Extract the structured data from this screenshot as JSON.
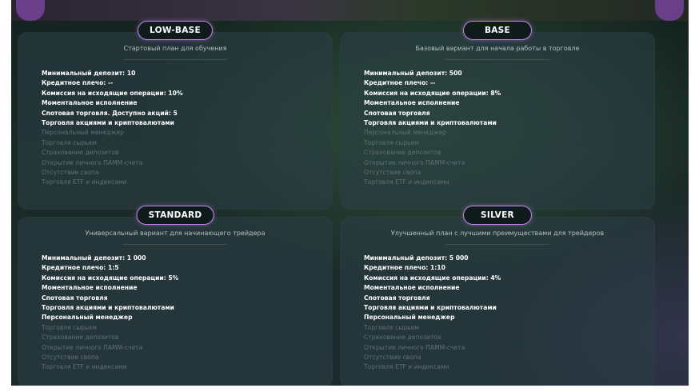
{
  "plans": [
    {
      "name": "LOW-BASE",
      "subtitle": "Стартовый план для обучения",
      "features": [
        {
          "text": "Минимальный депозит: 10",
          "enabled": true
        },
        {
          "text": "Кредитное плечо: --",
          "enabled": true
        },
        {
          "text": "Комиссия на исходящие операции: 10%",
          "enabled": true
        },
        {
          "text": "Моментальное исполнение",
          "enabled": true
        },
        {
          "text": "Спотовая торговля. Доступно акций: 5",
          "enabled": true
        },
        {
          "text": "Торговля акциями и криптовалютами",
          "enabled": true
        },
        {
          "text": "Персональный менеджер",
          "enabled": false
        },
        {
          "text": "Торговля сырьем",
          "enabled": false
        },
        {
          "text": "Страхование депозитов",
          "enabled": false
        },
        {
          "text": "Открытие личного ПАММ-счета",
          "enabled": false
        },
        {
          "text": "Отсутствие свопа",
          "enabled": false
        },
        {
          "text": "Торговля ETF и индексами",
          "enabled": false
        }
      ]
    },
    {
      "name": "BASE",
      "subtitle": "Базовый вариант для начала работы в торговле",
      "features": [
        {
          "text": "Минимальный депозит: 500",
          "enabled": true
        },
        {
          "text": "Кредитное плечо: --",
          "enabled": true
        },
        {
          "text": "Комиссия на исходящие операции: 8%",
          "enabled": true
        },
        {
          "text": "Моментальное исполнение",
          "enabled": true
        },
        {
          "text": "Спотовая торговля",
          "enabled": true
        },
        {
          "text": "Торговля акциями и криптовалютами",
          "enabled": true
        },
        {
          "text": "Персональный менеджер",
          "enabled": false
        },
        {
          "text": "Торговля сырьем",
          "enabled": false
        },
        {
          "text": "Страхование депозитов",
          "enabled": false
        },
        {
          "text": "Открытие личного ПАММ-счета",
          "enabled": false
        },
        {
          "text": "Отсутствие свопа",
          "enabled": false
        },
        {
          "text": "Торговля ETF и индексами",
          "enabled": false
        }
      ]
    },
    {
      "name": "STANDARD",
      "subtitle": "Универсальный вариант для начинающего трейдера",
      "features": [
        {
          "text": "Минимальный депозит: 1 000",
          "enabled": true
        },
        {
          "text": "Кредитное плечо: 1:5",
          "enabled": true
        },
        {
          "text": "Комиссия на исходящие операции: 5%",
          "enabled": true
        },
        {
          "text": "Моментальное исполнение",
          "enabled": true
        },
        {
          "text": "Спотовая торговля",
          "enabled": true
        },
        {
          "text": "Торговля акциями и криптовалютами",
          "enabled": true
        },
        {
          "text": "Персональный менеджер",
          "enabled": true
        },
        {
          "text": "Торговля сырьем",
          "enabled": false
        },
        {
          "text": "Страхование депозитов",
          "enabled": false
        },
        {
          "text": "Открытие личного ПАММ-счета",
          "enabled": false
        },
        {
          "text": "Отсутствие свопа",
          "enabled": false
        },
        {
          "text": "Торговля ETF и индексами",
          "enabled": false
        }
      ]
    },
    {
      "name": "SILVER",
      "subtitle": "Улучшенный план с лучшими преимуществами для трейдеров",
      "features": [
        {
          "text": "Минимальный депозит: 5 000",
          "enabled": true
        },
        {
          "text": "Кредитное плечо: 1:10",
          "enabled": true
        },
        {
          "text": "Комиссия на исходящие операции: 4%",
          "enabled": true
        },
        {
          "text": "Моментальное исполнение",
          "enabled": true
        },
        {
          "text": "Спотовая торговля",
          "enabled": true
        },
        {
          "text": "Торговля акциями и криптовалютами",
          "enabled": true
        },
        {
          "text": "Персональный менеджер",
          "enabled": true
        },
        {
          "text": "Торговля сырьем",
          "enabled": false
        },
        {
          "text": "Страхование депозитов",
          "enabled": false
        },
        {
          "text": "Открытие личного ПАММ-счета",
          "enabled": false
        },
        {
          "text": "Отсутствие свопа",
          "enabled": false
        },
        {
          "text": "Торговля ETF и индексами",
          "enabled": false
        }
      ]
    }
  ],
  "colors": {
    "accent": "#c184ea",
    "enabled_text": "#ffffff",
    "disabled_text": "#5f7075"
  }
}
